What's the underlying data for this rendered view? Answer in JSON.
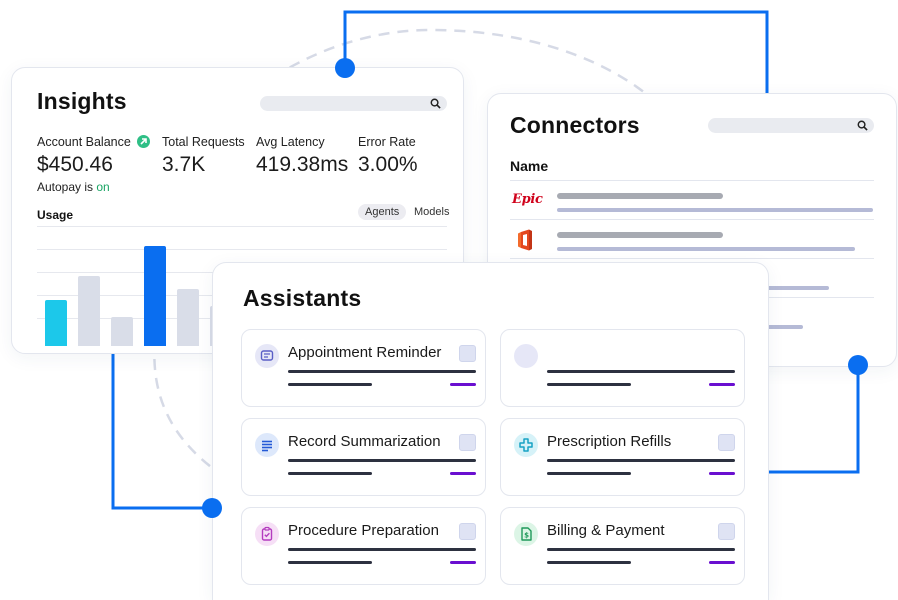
{
  "colors": {
    "accent": "#0a6ef0",
    "cyan": "#1cc8ea",
    "bar_gray": "#d9dde8",
    "autopay_on": "#1aa564",
    "purple": "#6a0fd0"
  },
  "insights": {
    "title": "Insights",
    "search_placeholder": "",
    "metrics": [
      {
        "label": "Account Balance",
        "value": "$450.46"
      },
      {
        "label": "Total Requests",
        "value": "3.7K"
      },
      {
        "label": "Avg Latency",
        "value": "419.38ms"
      },
      {
        "label": "Error Rate",
        "value": "3.00%"
      }
    ],
    "autopay_prefix": "Autopay is ",
    "autopay_state": "on",
    "usage_label": "Usage",
    "tabs": [
      "Agents",
      "Models"
    ],
    "selected_tab": "Agents",
    "usage_bars": [
      {
        "value": 0.46,
        "color": "cyan"
      },
      {
        "value": 0.7,
        "color": "gray"
      },
      {
        "value": 0.29,
        "color": "gray"
      },
      {
        "value": 1.0,
        "color": "blue"
      },
      {
        "value": 0.57,
        "color": "gray"
      },
      {
        "value": 0.4,
        "color": "gray"
      }
    ]
  },
  "assistants": {
    "title": "Assistants",
    "items": [
      {
        "name": "Appointment Reminder",
        "icon": "message-icon",
        "icon_color": "#e6e7f7",
        "glyph_color": "#5a5fc6"
      },
      {
        "name": "",
        "icon": "",
        "icon_color": "#e6e7f7",
        "glyph_color": "#5a5fc6"
      },
      {
        "name": "Record Summarization",
        "icon": "document-lines-icon",
        "icon_color": "#dde8fb",
        "glyph_color": "#2459d6"
      },
      {
        "name": "Prescription Refills",
        "icon": "medical-cross-icon",
        "icon_color": "#d6f2f8",
        "glyph_color": "#17a2c4"
      },
      {
        "name": "Procedure Preparation",
        "icon": "clipboard-check-icon",
        "icon_color": "#f6dff6",
        "glyph_color": "#b43cbf"
      },
      {
        "name": "Billing & Payment",
        "icon": "invoice-dollar-icon",
        "icon_color": "#dcf5e6",
        "glyph_color": "#1f9a5a"
      }
    ]
  },
  "connectors": {
    "title": "Connectors",
    "column_header": "Name",
    "rows": [
      {
        "logo": "epic-logo",
        "logo_text": "Epic"
      },
      {
        "logo": "office-logo-icon",
        "logo_text": ""
      },
      {
        "logo": "calendar-icon",
        "logo_text": ""
      },
      {
        "logo": "xray-chest-icon",
        "logo_text": ""
      }
    ]
  }
}
